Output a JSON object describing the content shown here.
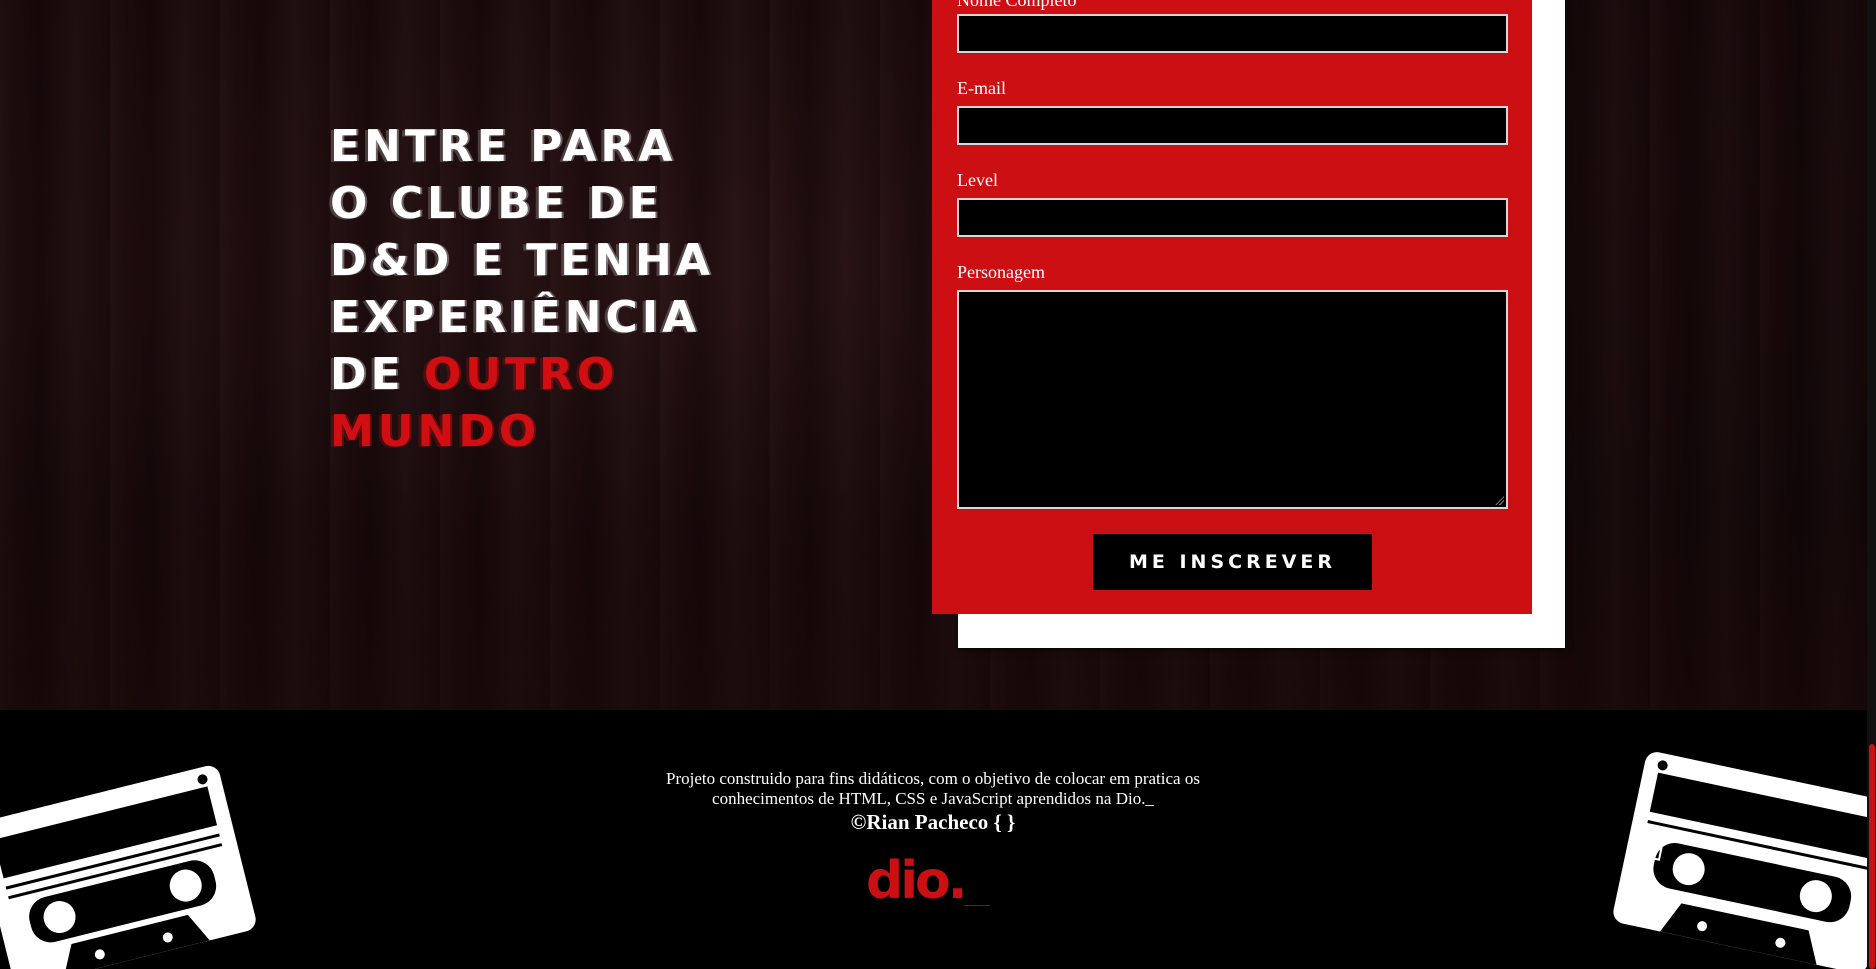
{
  "headline": {
    "line1": "Entre para",
    "line2": "o clube de",
    "line3": "D&D e tenha",
    "line4": "experiência",
    "line5_prefix": "de ",
    "accent1": "outro",
    "accent2": "mundo"
  },
  "form": {
    "name_label": "Nome Completo",
    "email_label": "E-mail",
    "level_label": "Level",
    "character_label": "Personagem",
    "submit_label": "Me inscrever",
    "name_value": "",
    "email_value": "",
    "level_value": "",
    "character_value": ""
  },
  "footer": {
    "line1": "Projeto construido para fins didáticos, com o objetivo de colocar em pratica os",
    "line2": "conhecimentos de HTML, CSS e JavaScript aprendidos na Dio._",
    "credit": "©Rian Pacheco { }",
    "logo_text": "dio._"
  },
  "colors": {
    "accent": "#cc0f12",
    "background": "#000000",
    "text": "#ffffff"
  },
  "icons": [
    "cassette-tape-icon",
    "dio-logo-icon"
  ]
}
